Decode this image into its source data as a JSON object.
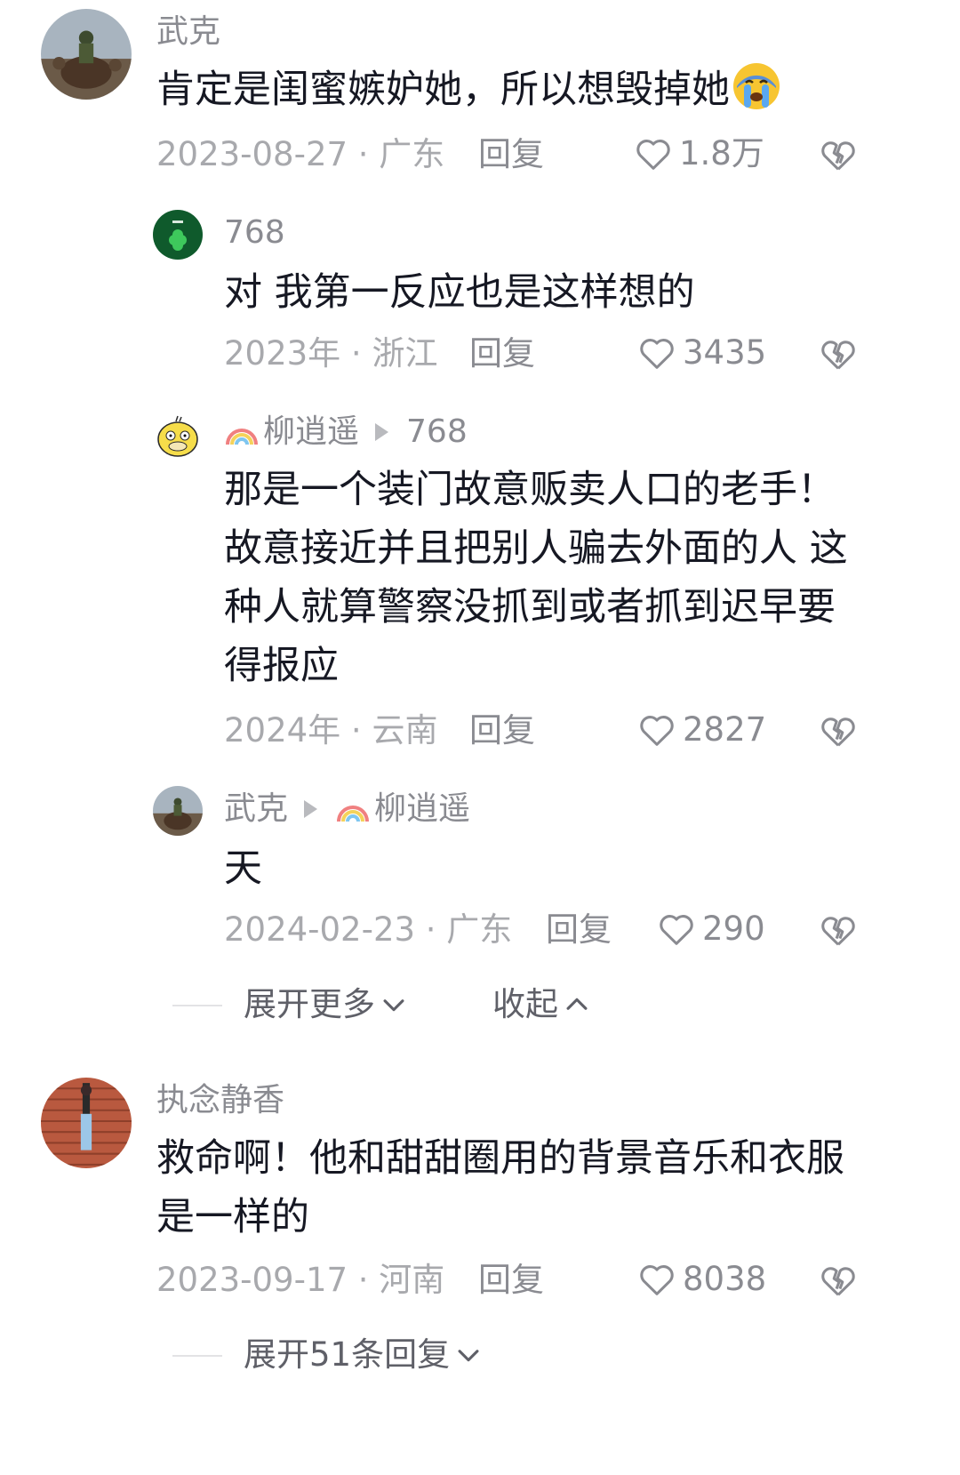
{
  "comments": [
    {
      "user": "武克",
      "text": "肯定是闺蜜嫉妒她，所以想毁掉她",
      "emoji": "crying-emoji",
      "date": "2023-08-27 · 广东",
      "reply_label": "回复",
      "likes": "1.8万",
      "replies": [
        {
          "user": "768",
          "text": "对 我第一反应也是这样想的",
          "date": "2023年 · 浙江",
          "reply_label": "回复",
          "likes": "3435"
        },
        {
          "user": "柳逍遥",
          "reply_to": "768",
          "text": "那是一个装门故意贩卖人口的老手！故意接近并且把别人骗去外面的人 这种人就算警察没抓到或者抓到迟早要得报应",
          "date": "2024年 · 云南",
          "reply_label": "回复",
          "likes": "2827"
        },
        {
          "user": "武克",
          "reply_to": "柳逍遥",
          "text": "天",
          "date": "2024-02-23 · 广东",
          "reply_label": "回复",
          "likes": "290"
        }
      ],
      "expand_more": "展开更多",
      "collapse": "收起"
    },
    {
      "user": "执念静香",
      "text": "救命啊！他和甜甜圈用的背景音乐和衣服是一样的",
      "date": "2023-09-17 · 河南",
      "reply_label": "回复",
      "likes": "8038",
      "expand_replies": "展开51条回复"
    }
  ],
  "colors": {
    "text": "#161823",
    "meta": "#a8a9ad",
    "username": "#8a8b91",
    "icon": "#8a8b91"
  }
}
